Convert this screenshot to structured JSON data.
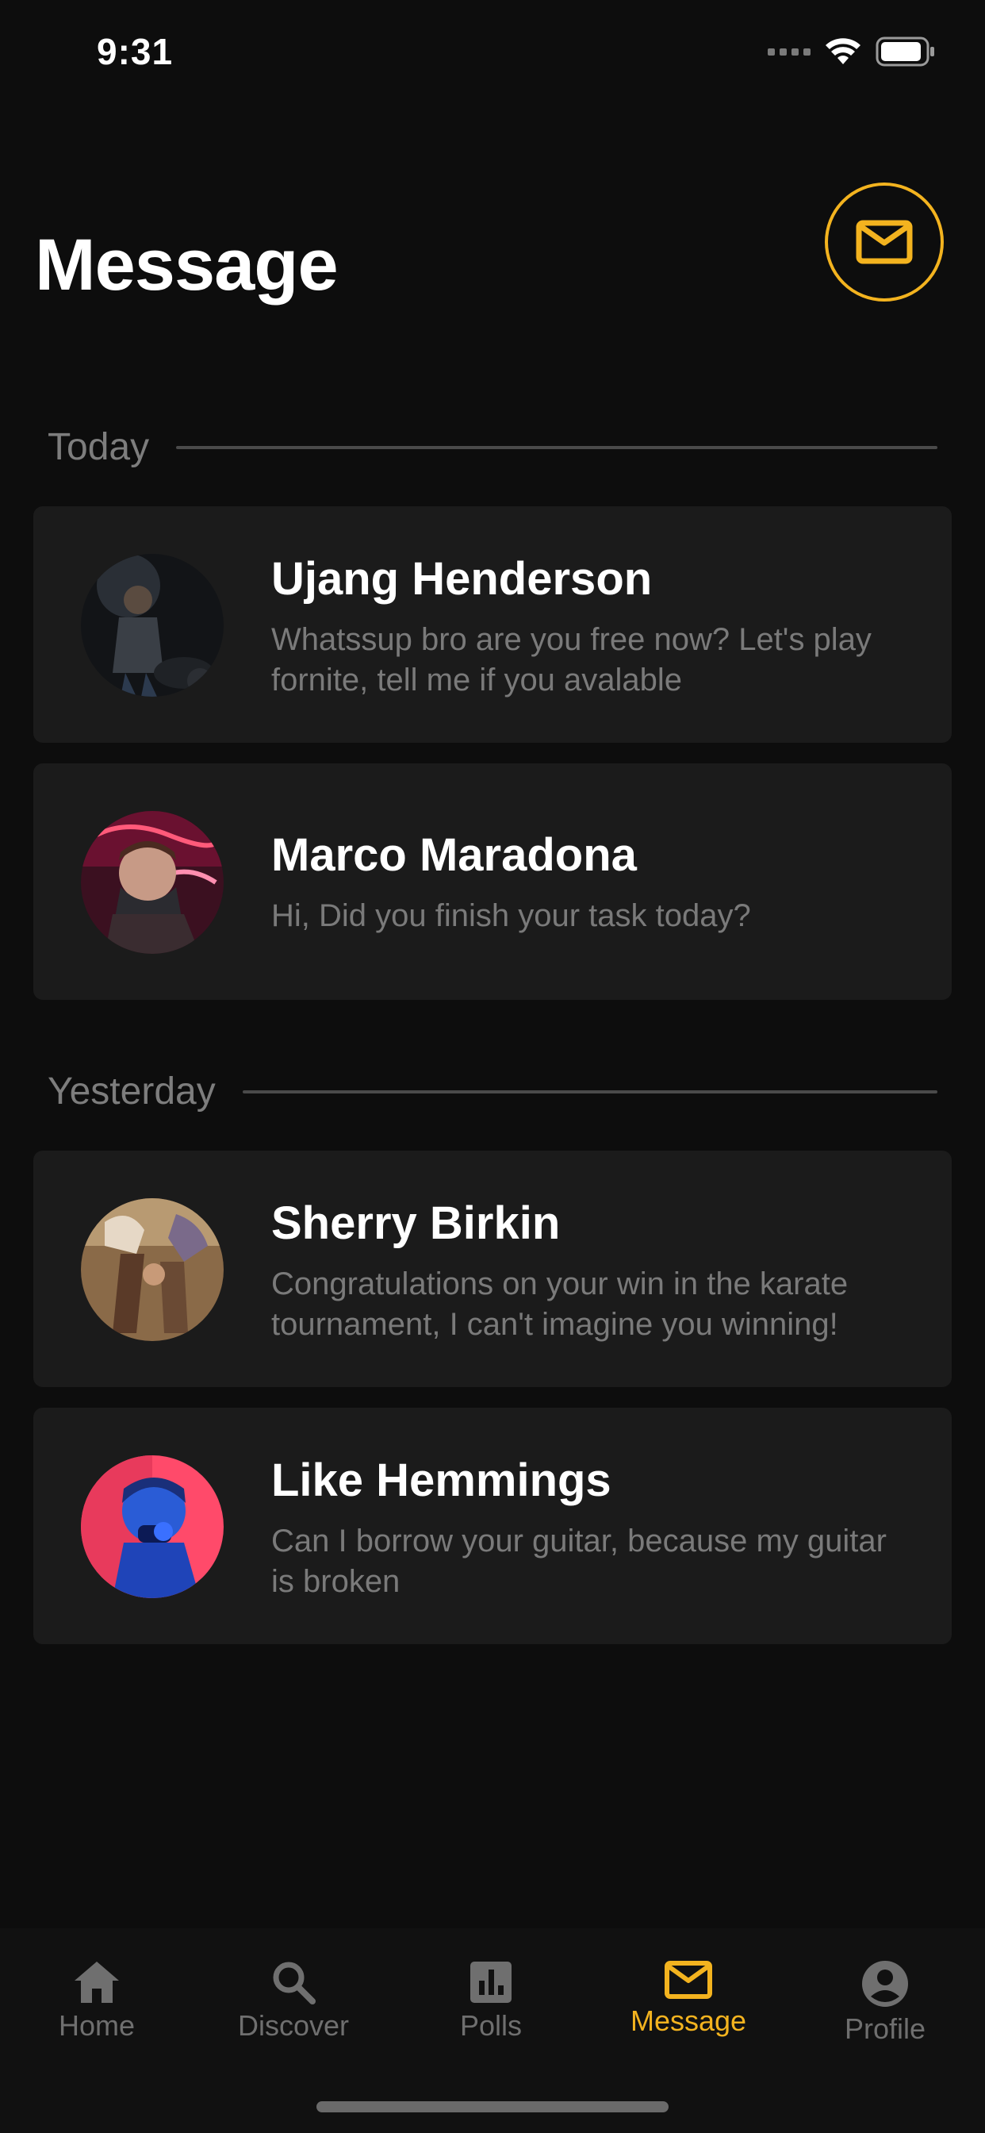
{
  "status_bar": {
    "time": "9:31"
  },
  "header": {
    "title": "Message",
    "compose_icon": "mail-icon",
    "accent_color": "#f3b31f"
  },
  "sections": [
    {
      "label": "Today",
      "messages": [
        {
          "name": "Ujang Henderson",
          "preview": "Whatssup bro are you free now? Let's play fornite, tell me if you avalable"
        },
        {
          "name": "Marco Maradona",
          "preview": "Hi, Did you finish your task today?"
        }
      ]
    },
    {
      "label": "Yesterday",
      "messages": [
        {
          "name": "Sherry Birkin",
          "preview": "Congratulations on your win in the karate tournament, I can't imagine you winning!"
        },
        {
          "name": "Like Hemmings",
          "preview": "Can I borrow your guitar, because my guitar is broken"
        }
      ]
    }
  ],
  "tab_bar": {
    "tabs": [
      {
        "label": "Home",
        "icon": "home-icon"
      },
      {
        "label": "Discover",
        "icon": "search-icon"
      },
      {
        "label": "Polls",
        "icon": "bar-chart-icon"
      },
      {
        "label": "Message",
        "icon": "mail-icon",
        "active": true
      },
      {
        "label": "Profile",
        "icon": "account-circle-icon"
      }
    ]
  }
}
